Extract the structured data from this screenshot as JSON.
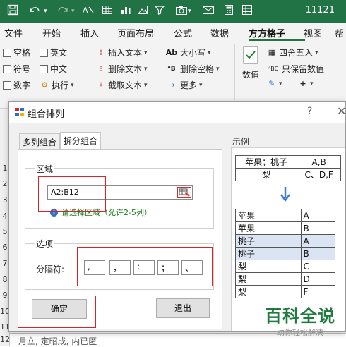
{
  "excel": {
    "window_title": "11121",
    "quick_access_icons": [
      "save-icon",
      "undo-icon",
      "undo-dropdown-icon",
      "redo-icon",
      "redo-dropdown-icon",
      "text-format-icon",
      "table-icon",
      "chart-icon",
      "image-icon",
      "filter-icon",
      "camera-icon",
      "dropdown-icon",
      "mail-icon",
      "calculator-icon",
      "grid-icon"
    ],
    "tabs": [
      "文件",
      "开始",
      "插入",
      "页面布局",
      "公式",
      "数据",
      "方方格子",
      "视图",
      "帮"
    ],
    "active_tab": "方方格子",
    "ribbon": {
      "checks": [
        "空格",
        "英文",
        "符号",
        "中文",
        "数字",
        "执行"
      ],
      "text_ops": [
        "插入文本",
        "删除文本",
        "截取文本"
      ],
      "case_ops": [
        "大小写",
        "删除空格",
        "更多"
      ],
      "number_label": "数值",
      "round_label": "四舍五入",
      "keep_label": "只保留数值"
    },
    "row_headers": [
      "1",
      "2",
      "3",
      "4",
      "5",
      "6",
      "7",
      "8",
      "9",
      "10",
      "11",
      "12"
    ],
    "bottom_row_text": "月立, 定昭成, 内已匿"
  },
  "dialog": {
    "title": "组合排列",
    "help": "?",
    "close": "✕",
    "tabs": [
      "多列组合",
      "拆分组合"
    ],
    "active_tab": "拆分组合",
    "area_group_title": "区域",
    "range_value": "A2:B12",
    "hint": "请选择区域（允许2-5列）",
    "options_group_title": "选项",
    "separator_label": "分隔符:",
    "separators": [
      ",",
      "，",
      ";",
      "；",
      "、"
    ],
    "ok_button": "确定",
    "exit_button": "退出",
    "example": {
      "label": "示例",
      "source_rows": [
        [
          "苹果；桃子",
          "A,B"
        ],
        [
          "梨",
          "C、D,F"
        ]
      ],
      "result_rows": [
        [
          "苹果",
          "A"
        ],
        [
          "苹果",
          "B"
        ],
        [
          "桃子",
          "A"
        ],
        [
          "桃子",
          "B"
        ],
        [
          "梨",
          "C"
        ],
        [
          "梨",
          "D"
        ],
        [
          "梨",
          "F"
        ]
      ],
      "highlighted_rows": [
        2,
        3
      ]
    }
  },
  "watermark": {
    "title": "百科全说",
    "subtitle": "助你轻松解决"
  },
  "colors": {
    "excel_green": "#217346",
    "highlight_red": "#d9252a",
    "hint_green": "#1b7a1b",
    "row_highlight": "#dbe4f3"
  }
}
